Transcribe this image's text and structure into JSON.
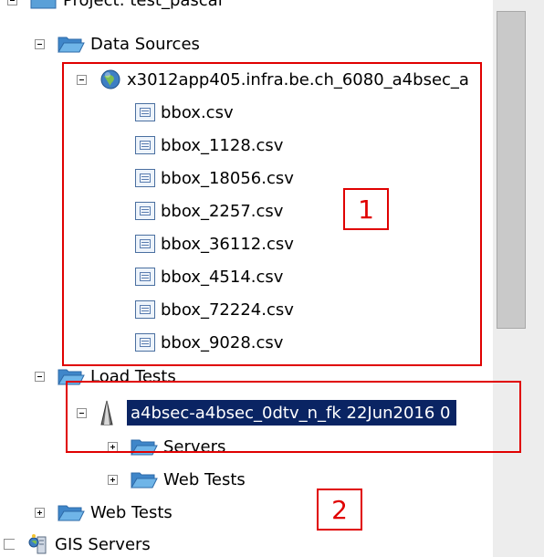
{
  "tree": {
    "project_label": "Project: test_pascal",
    "data_sources": {
      "label": "Data Sources",
      "server": "x3012app405.infra.be.ch_6080_a4bsec_a",
      "files": [
        "bbox.csv",
        "bbox_1128.csv",
        "bbox_18056.csv",
        "bbox_2257.csv",
        "bbox_36112.csv",
        "bbox_4514.csv",
        "bbox_72224.csv",
        "bbox_9028.csv"
      ]
    },
    "load_tests": {
      "label": "Load Tests",
      "selected_test": "a4bsec-a4bsec_0dtv_n_fk  22Jun2016  0",
      "servers": "Servers",
      "web_tests": "Web Tests"
    },
    "web_tests": "Web Tests",
    "gis_servers": "GIS Servers"
  },
  "annotations": {
    "box1": "1",
    "box2": "2"
  },
  "colors": {
    "selection": "#0a2463",
    "annotation": "#e00000",
    "folder": "#5aa0d8"
  }
}
